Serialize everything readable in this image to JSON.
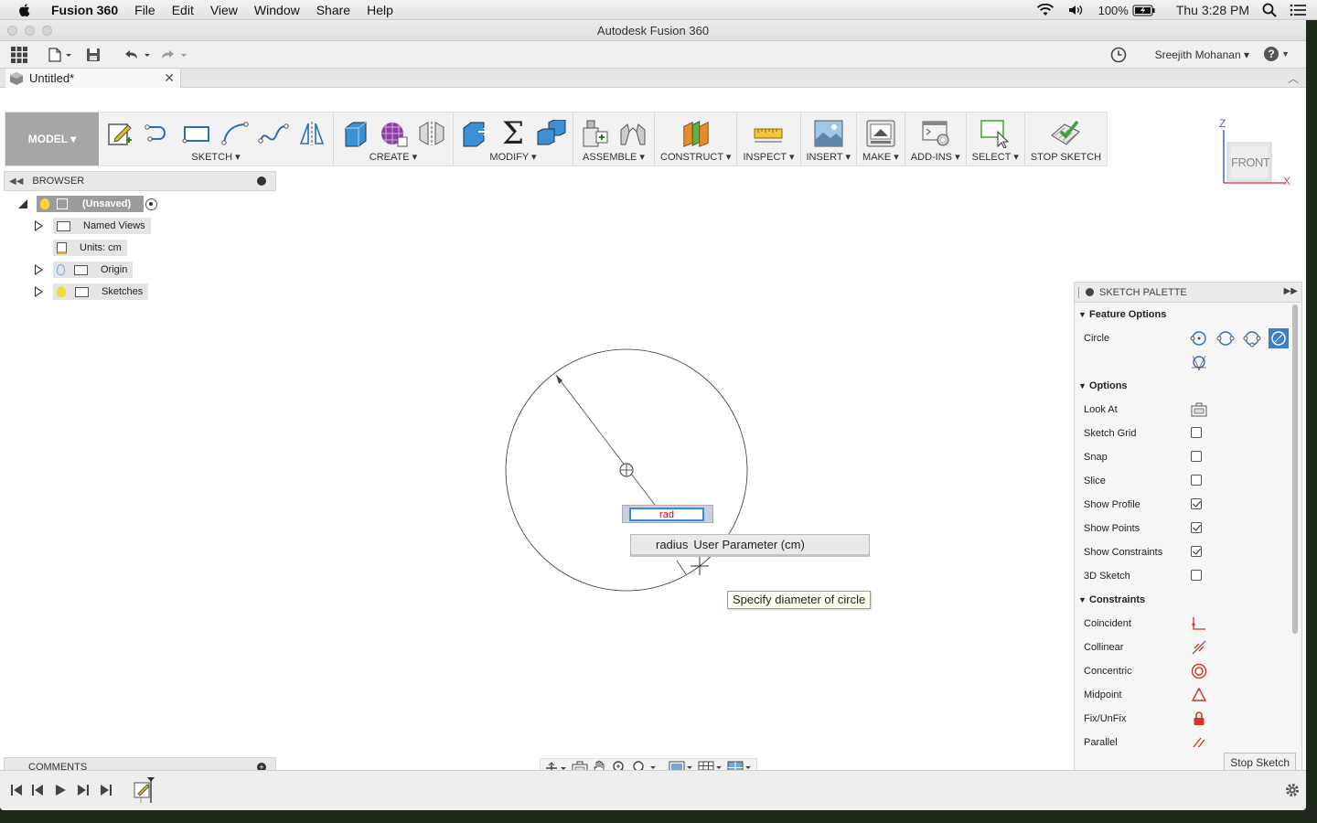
{
  "menubar": {
    "app_name": "Fusion 360",
    "menus": [
      "File",
      "Edit",
      "View",
      "Window",
      "Share",
      "Help"
    ],
    "battery": "100%",
    "clock": "Thu 3:28 PM"
  },
  "window": {
    "title": "Autodesk Fusion 360"
  },
  "qat": {
    "user": "Sreejith Mohanan ▾",
    "help_label": "?"
  },
  "tab": {
    "label": "Untitled*"
  },
  "toolbar": {
    "mode": "MODEL ▾",
    "groups": {
      "sketch": "SKETCH ▾",
      "create": "CREATE ▾",
      "modify": "MODIFY ▾",
      "assemble": "ASSEMBLE ▾",
      "construct": "CONSTRUCT ▾",
      "inspect": "INSPECT ▾",
      "insert": "INSERT ▾",
      "make": "MAKE ▾",
      "addins": "ADD-INS ▾",
      "select": "SELECT ▾",
      "stop": "STOP SKETCH"
    },
    "sigma": "Σ"
  },
  "viewcube": {
    "face": "FRONT",
    "z": "Z",
    "x": "X"
  },
  "browser": {
    "title": "BROWSER",
    "root": "(Unsaved)",
    "items": [
      "Named Views",
      "Units: cm",
      "Origin",
      "Sketches"
    ]
  },
  "sketch": {
    "input_value": "rad",
    "suggestion_keyword": "radius",
    "suggestion_detail": "User Parameter (cm)",
    "tooltip": "Specify diameter of circle"
  },
  "palette": {
    "title": "SKETCH PALETTE",
    "feature_options": "Feature Options",
    "circle_label": "Circle",
    "options_label": "Options",
    "options": [
      {
        "label": "Look At"
      },
      {
        "label": "Sketch Grid",
        "checked": false
      },
      {
        "label": "Snap",
        "checked": false
      },
      {
        "label": "Slice",
        "checked": false
      },
      {
        "label": "Show Profile",
        "checked": true
      },
      {
        "label": "Show Points",
        "checked": true
      },
      {
        "label": "Show Constraints",
        "checked": true
      },
      {
        "label": "3D Sketch",
        "checked": false
      }
    ],
    "constraints_label": "Constraints",
    "constraints": [
      "Coincident",
      "Collinear",
      "Concentric",
      "Midpoint",
      "Fix/UnFix",
      "Parallel"
    ],
    "stop_button": "Stop Sketch",
    "constraint_color": "#d9312b"
  },
  "comments": {
    "title": "COMMENTS"
  }
}
